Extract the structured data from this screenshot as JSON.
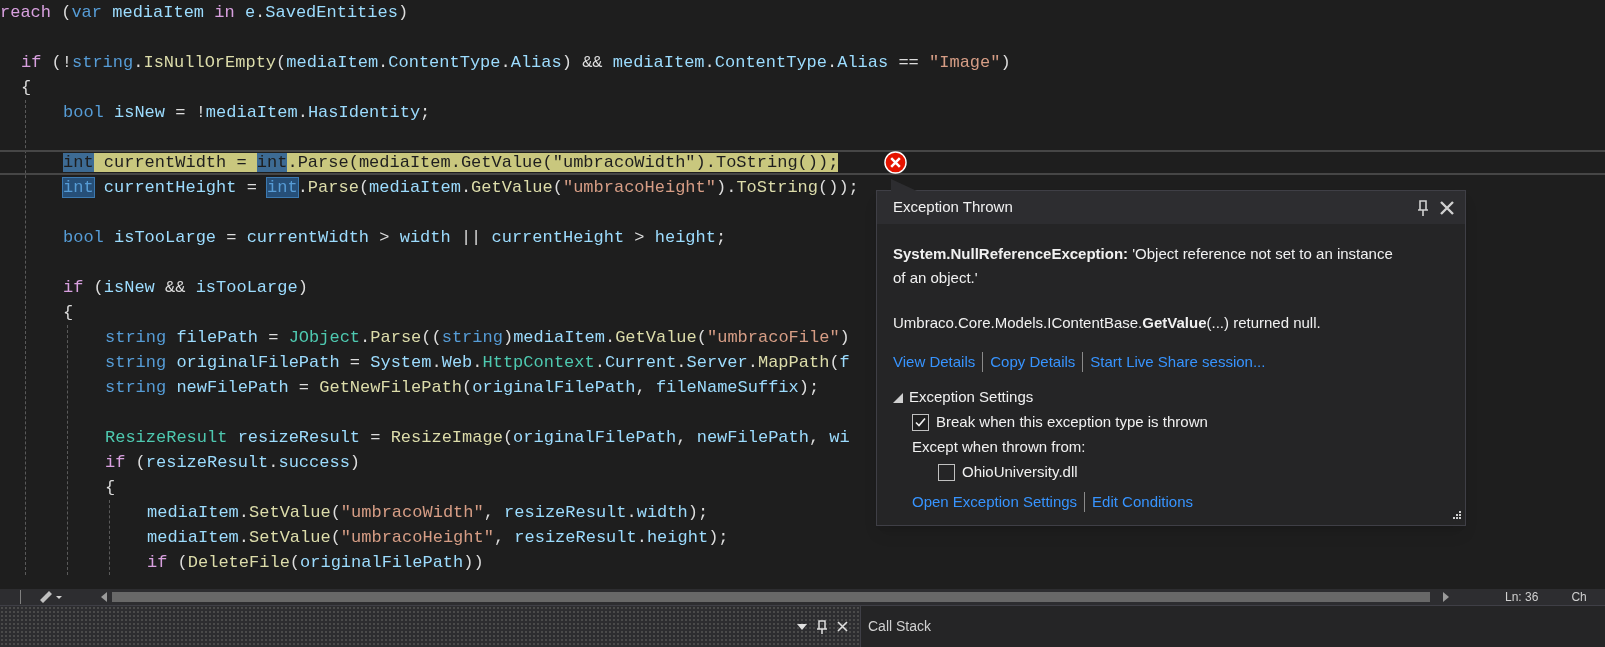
{
  "editor": {
    "lines": [
      {
        "tokens": [
          {
            "kind": "control",
            "text": "reach"
          },
          {
            "kind": "plain",
            "text": " ("
          },
          {
            "kind": "keyword",
            "text": "var "
          },
          {
            "kind": "ident",
            "text": "mediaItem "
          },
          {
            "kind": "control",
            "text": "in "
          },
          {
            "kind": "ident",
            "text": "e"
          },
          {
            "kind": "plain",
            "text": "."
          },
          {
            "kind": "ident",
            "text": "SavedEntities"
          },
          {
            "kind": "plain",
            "text": ")"
          }
        ],
        "children": [
          {
            "gap_before": true,
            "tokens": [
              {
                "kind": "control",
                "text": "if"
              },
              {
                "kind": "plain",
                "text": " (!"
              },
              {
                "kind": "keyword",
                "text": "string"
              },
              {
                "kind": "plain",
                "text": "."
              },
              {
                "kind": "method",
                "text": "IsNullOrEmpty"
              },
              {
                "kind": "plain",
                "text": "("
              },
              {
                "kind": "ident",
                "text": "mediaItem"
              },
              {
                "kind": "plain",
                "text": "."
              },
              {
                "kind": "ident",
                "text": "ContentType"
              },
              {
                "kind": "plain",
                "text": "."
              },
              {
                "kind": "ident",
                "text": "Alias"
              },
              {
                "kind": "plain",
                "text": ") && "
              },
              {
                "kind": "ident",
                "text": "mediaItem"
              },
              {
                "kind": "plain",
                "text": "."
              },
              {
                "kind": "ident",
                "text": "ContentType"
              },
              {
                "kind": "plain",
                "text": "."
              },
              {
                "kind": "ident",
                "text": "Alias"
              },
              {
                "kind": "plain",
                "text": " == "
              },
              {
                "kind": "string",
                "text": "\"Image\""
              },
              {
                "kind": "plain",
                "text": ")"
              }
            ]
          },
          {
            "tokens": [
              {
                "kind": "plain",
                "text": "{"
              }
            ],
            "children": [
              {
                "tokens": [
                  {
                    "kind": "keyword",
                    "text": "bool "
                  },
                  {
                    "kind": "ident",
                    "text": "isNew"
                  },
                  {
                    "kind": "plain",
                    "text": " = !"
                  },
                  {
                    "kind": "ident",
                    "text": "mediaItem"
                  },
                  {
                    "kind": "plain",
                    "text": "."
                  },
                  {
                    "kind": "ident",
                    "text": "HasIdentity"
                  },
                  {
                    "kind": "plain",
                    "text": ";"
                  }
                ]
              },
              {
                "gap_before": true,
                "current": true,
                "tokens": [
                  {
                    "kind": "match",
                    "text": "int"
                  },
                  {
                    "kind": "ident",
                    "text": " currentWidth"
                  },
                  {
                    "kind": "plain",
                    "text": " = "
                  },
                  {
                    "kind": "match",
                    "text": "int"
                  },
                  {
                    "kind": "plain",
                    "text": "."
                  },
                  {
                    "kind": "method",
                    "text": "Parse"
                  },
                  {
                    "kind": "plain",
                    "text": "("
                  },
                  {
                    "kind": "ident",
                    "text": "mediaItem"
                  },
                  {
                    "kind": "plain",
                    "text": "."
                  },
                  {
                    "kind": "method",
                    "text": "GetValue"
                  },
                  {
                    "kind": "plain",
                    "text": "("
                  },
                  {
                    "kind": "string",
                    "text": "\"umbracoWidth\""
                  },
                  {
                    "kind": "plain",
                    "text": ")."
                  },
                  {
                    "kind": "method",
                    "text": "ToString"
                  },
                  {
                    "kind": "plain",
                    "text": "());"
                  }
                ]
              },
              {
                "tokens": [
                  {
                    "kind": "match",
                    "text": "int"
                  },
                  {
                    "kind": "ident",
                    "text": " currentHeight"
                  },
                  {
                    "kind": "plain",
                    "text": " = "
                  },
                  {
                    "kind": "match",
                    "text": "int"
                  },
                  {
                    "kind": "plain",
                    "text": "."
                  },
                  {
                    "kind": "method",
                    "text": "Parse"
                  },
                  {
                    "kind": "plain",
                    "text": "("
                  },
                  {
                    "kind": "ident",
                    "text": "mediaItem"
                  },
                  {
                    "kind": "plain",
                    "text": "."
                  },
                  {
                    "kind": "method",
                    "text": "GetValue"
                  },
                  {
                    "kind": "plain",
                    "text": "("
                  },
                  {
                    "kind": "string",
                    "text": "\"umbracoHeight\""
                  },
                  {
                    "kind": "plain",
                    "text": ")."
                  },
                  {
                    "kind": "method",
                    "text": "ToString"
                  },
                  {
                    "kind": "plain",
                    "text": "());"
                  }
                ]
              },
              {
                "gap_before": true,
                "tokens": [
                  {
                    "kind": "keyword",
                    "text": "bool "
                  },
                  {
                    "kind": "ident",
                    "text": "isTooLarge"
                  },
                  {
                    "kind": "plain",
                    "text": " = "
                  },
                  {
                    "kind": "ident",
                    "text": "currentWidth"
                  },
                  {
                    "kind": "plain",
                    "text": " > "
                  },
                  {
                    "kind": "ident",
                    "text": "width"
                  },
                  {
                    "kind": "plain",
                    "text": " || "
                  },
                  {
                    "kind": "ident",
                    "text": "currentHeight"
                  },
                  {
                    "kind": "plain",
                    "text": " > "
                  },
                  {
                    "kind": "ident",
                    "text": "height"
                  },
                  {
                    "kind": "plain",
                    "text": ";"
                  }
                ]
              },
              {
                "gap_before": true,
                "tokens": [
                  {
                    "kind": "control",
                    "text": "if"
                  },
                  {
                    "kind": "plain",
                    "text": " ("
                  },
                  {
                    "kind": "ident",
                    "text": "isNew"
                  },
                  {
                    "kind": "plain",
                    "text": " && "
                  },
                  {
                    "kind": "ident",
                    "text": "isTooLarge"
                  },
                  {
                    "kind": "plain",
                    "text": ")"
                  }
                ]
              },
              {
                "tokens": [
                  {
                    "kind": "plain",
                    "text": "{"
                  }
                ],
                "children": [
                  {
                    "tokens": [
                      {
                        "kind": "keyword",
                        "text": "string "
                      },
                      {
                        "kind": "ident",
                        "text": "filePath"
                      },
                      {
                        "kind": "plain",
                        "text": " = "
                      },
                      {
                        "kind": "type",
                        "text": "JObject"
                      },
                      {
                        "kind": "plain",
                        "text": "."
                      },
                      {
                        "kind": "method",
                        "text": "Parse"
                      },
                      {
                        "kind": "plain",
                        "text": "(("
                      },
                      {
                        "kind": "keyword",
                        "text": "string"
                      },
                      {
                        "kind": "plain",
                        "text": ")"
                      },
                      {
                        "kind": "ident",
                        "text": "mediaItem"
                      },
                      {
                        "kind": "plain",
                        "text": "."
                      },
                      {
                        "kind": "method",
                        "text": "GetValue"
                      },
                      {
                        "kind": "plain",
                        "text": "("
                      },
                      {
                        "kind": "string",
                        "text": "\"umbracoFile\""
                      },
                      {
                        "kind": "plain",
                        "text": ")"
                      }
                    ]
                  },
                  {
                    "tokens": [
                      {
                        "kind": "keyword",
                        "text": "string "
                      },
                      {
                        "kind": "ident",
                        "text": "originalFilePath"
                      },
                      {
                        "kind": "plain",
                        "text": " = "
                      },
                      {
                        "kind": "ident",
                        "text": "System"
                      },
                      {
                        "kind": "plain",
                        "text": "."
                      },
                      {
                        "kind": "ident",
                        "text": "Web"
                      },
                      {
                        "kind": "plain",
                        "text": "."
                      },
                      {
                        "kind": "type",
                        "text": "HttpContext"
                      },
                      {
                        "kind": "plain",
                        "text": "."
                      },
                      {
                        "kind": "ident",
                        "text": "Current"
                      },
                      {
                        "kind": "plain",
                        "text": "."
                      },
                      {
                        "kind": "ident",
                        "text": "Server"
                      },
                      {
                        "kind": "plain",
                        "text": "."
                      },
                      {
                        "kind": "method",
                        "text": "MapPath"
                      },
                      {
                        "kind": "plain",
                        "text": "("
                      },
                      {
                        "kind": "ident",
                        "text": "f"
                      }
                    ]
                  },
                  {
                    "tokens": [
                      {
                        "kind": "keyword",
                        "text": "string "
                      },
                      {
                        "kind": "ident",
                        "text": "newFilePath"
                      },
                      {
                        "kind": "plain",
                        "text": " = "
                      },
                      {
                        "kind": "method",
                        "text": "GetNewFilePath"
                      },
                      {
                        "kind": "plain",
                        "text": "("
                      },
                      {
                        "kind": "ident",
                        "text": "originalFilePath"
                      },
                      {
                        "kind": "plain",
                        "text": ", "
                      },
                      {
                        "kind": "ident",
                        "text": "fileNameSuffix"
                      },
                      {
                        "kind": "plain",
                        "text": ");"
                      }
                    ]
                  },
                  {
                    "gap_before": true,
                    "tokens": [
                      {
                        "kind": "type",
                        "text": "ResizeResult "
                      },
                      {
                        "kind": "ident",
                        "text": "resizeResult"
                      },
                      {
                        "kind": "plain",
                        "text": " = "
                      },
                      {
                        "kind": "method",
                        "text": "ResizeImage"
                      },
                      {
                        "kind": "plain",
                        "text": "("
                      },
                      {
                        "kind": "ident",
                        "text": "originalFilePath"
                      },
                      {
                        "kind": "plain",
                        "text": ", "
                      },
                      {
                        "kind": "ident",
                        "text": "newFilePath"
                      },
                      {
                        "kind": "plain",
                        "text": ", "
                      },
                      {
                        "kind": "ident",
                        "text": "wi"
                      }
                    ]
                  },
                  {
                    "tokens": [
                      {
                        "kind": "control",
                        "text": "if"
                      },
                      {
                        "kind": "plain",
                        "text": " ("
                      },
                      {
                        "kind": "ident",
                        "text": "resizeResult"
                      },
                      {
                        "kind": "plain",
                        "text": "."
                      },
                      {
                        "kind": "ident",
                        "text": "success"
                      },
                      {
                        "kind": "plain",
                        "text": ")"
                      }
                    ]
                  },
                  {
                    "tokens": [
                      {
                        "kind": "plain",
                        "text": "{"
                      }
                    ],
                    "children": [
                      {
                        "tokens": [
                          {
                            "kind": "ident",
                            "text": "mediaItem"
                          },
                          {
                            "kind": "plain",
                            "text": "."
                          },
                          {
                            "kind": "method",
                            "text": "SetValue"
                          },
                          {
                            "kind": "plain",
                            "text": "("
                          },
                          {
                            "kind": "string",
                            "text": "\"umbracoWidth\""
                          },
                          {
                            "kind": "plain",
                            "text": ", "
                          },
                          {
                            "kind": "ident",
                            "text": "resizeResult"
                          },
                          {
                            "kind": "plain",
                            "text": "."
                          },
                          {
                            "kind": "ident",
                            "text": "width"
                          },
                          {
                            "kind": "plain",
                            "text": ");"
                          }
                        ]
                      },
                      {
                        "tokens": [
                          {
                            "kind": "ident",
                            "text": "mediaItem"
                          },
                          {
                            "kind": "plain",
                            "text": "."
                          },
                          {
                            "kind": "method",
                            "text": "SetValue"
                          },
                          {
                            "kind": "plain",
                            "text": "("
                          },
                          {
                            "kind": "string",
                            "text": "\"umbracoHeight\""
                          },
                          {
                            "kind": "plain",
                            "text": ", "
                          },
                          {
                            "kind": "ident",
                            "text": "resizeResult"
                          },
                          {
                            "kind": "plain",
                            "text": "."
                          },
                          {
                            "kind": "ident",
                            "text": "height"
                          },
                          {
                            "kind": "plain",
                            "text": ");"
                          }
                        ]
                      },
                      {
                        "tokens": [
                          {
                            "kind": "control",
                            "text": "if"
                          },
                          {
                            "kind": "plain",
                            "text": " ("
                          },
                          {
                            "kind": "method",
                            "text": "DeleteFile"
                          },
                          {
                            "kind": "plain",
                            "text": "("
                          },
                          {
                            "kind": "ident",
                            "text": "originalFilePath"
                          },
                          {
                            "kind": "plain",
                            "text": "))"
                          }
                        ]
                      }
                    ]
                  }
                ]
              }
            ]
          }
        ]
      }
    ]
  },
  "exception_popup": {
    "title": "Exception Thrown",
    "message": "**System.NullReferenceException:** 'Object reference not set to an instance of an object.'",
    "detail": "Umbraco.Core.Models.IContentBase.**GetValue**(...) returned null.",
    "links": [
      "View Details",
      "Copy Details",
      "Start Live Share session..."
    ],
    "settings": {
      "label": "Exception Settings",
      "expanded": true,
      "options": [
        {
          "kind": "checkbox",
          "label": "Break when this exception type is thrown",
          "checked": true
        },
        {
          "kind": "text",
          "label": "Except when thrown from:",
          "children": [
            {
              "kind": "checkbox",
              "label": "OhioUniversity.dll",
              "checked": false
            }
          ]
        }
      ]
    },
    "footer_links": [
      "Open Exception Settings",
      "Edit Conditions"
    ]
  },
  "status": {
    "line": "Ln: 36",
    "column": "Ch"
  },
  "bottom_panel": {
    "tab": "Call Stack"
  }
}
